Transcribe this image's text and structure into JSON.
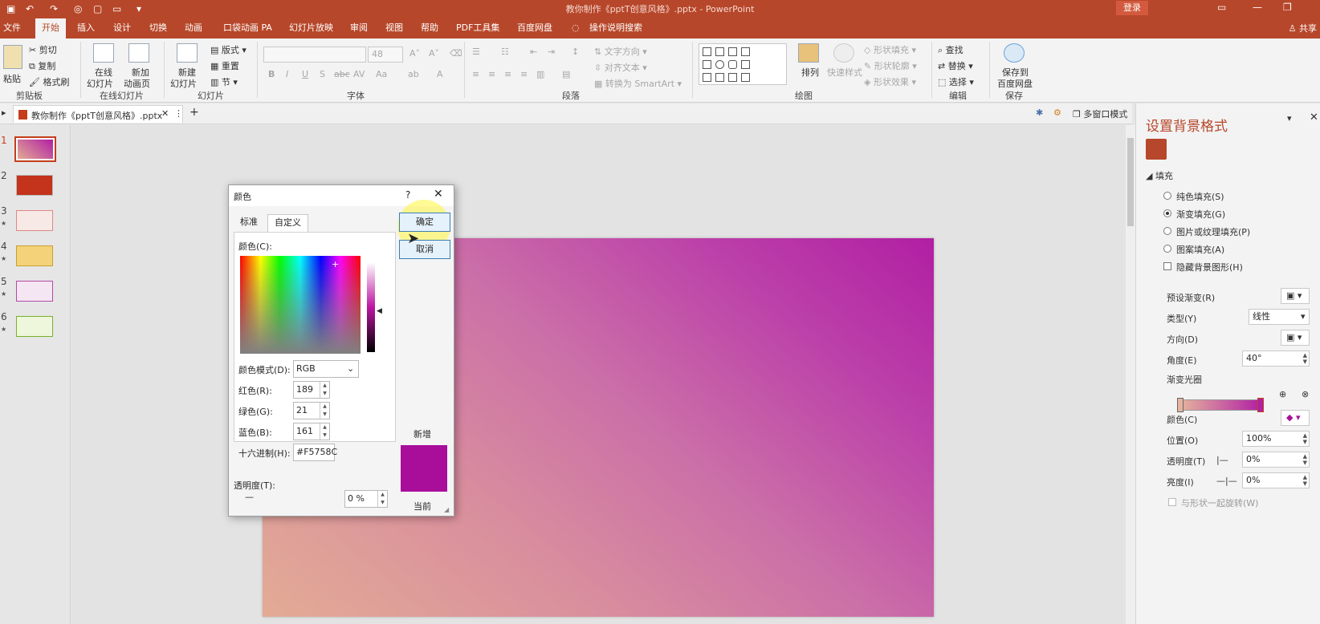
{
  "titlebar": {
    "doc_title": "教你制作《pptT创意风格》.pptx - PowerPoint",
    "login": "登录"
  },
  "tabs": [
    "文件",
    "开始",
    "插入",
    "设计",
    "切换",
    "动画",
    "口袋动画 PA",
    "幻灯片放映",
    "审阅",
    "视图",
    "帮助",
    "PDF工具集",
    "百度网盘"
  ],
  "active_tab": "开始",
  "search_hint": "操作说明搜索",
  "share": "共享",
  "ribbon": {
    "paste": "粘贴",
    "cut": "剪切",
    "copy": "复制",
    "format_painter": "格式刷",
    "online_slide_1": "在线",
    "online_slide_2": "幻灯片",
    "new_anim_1": "新加",
    "new_anim_2": "动画页",
    "new_slide_1": "新建",
    "new_slide_2": "幻灯片",
    "layout": "版式",
    "reset": "重置",
    "section": "节",
    "font_size": "48",
    "text_direction": "文字方向",
    "align_text": "对齐文本",
    "smartart": "转换为 SmartArt",
    "arrange": "排列",
    "quick_styles": "快速样式",
    "shape_fill": "形状填充",
    "shape_outline": "形状轮廓",
    "shape_effect": "形状效果",
    "find": "查找",
    "replace": "替换",
    "select": "选择",
    "save_1": "保存到",
    "save_2": "百度网盘",
    "groups": {
      "clipboard": "剪贴板",
      "online": "在线幻灯片",
      "slides": "幻灯片",
      "font": "字体",
      "paragraph": "段落",
      "drawing": "绘图",
      "editing": "编辑",
      "save": "保存"
    }
  },
  "doc_tab": "教你制作《pptT创意风格》.pptx",
  "multi_window": "多窗口模式",
  "thumbnails": [
    {
      "num": "1",
      "star": "",
      "selected": true
    },
    {
      "num": "2",
      "star": "",
      "selected": false
    },
    {
      "num": "3",
      "star": "★",
      "selected": false
    },
    {
      "num": "4",
      "star": "★",
      "selected": false
    },
    {
      "num": "5",
      "star": "★",
      "selected": false
    },
    {
      "num": "6",
      "star": "★",
      "selected": false
    }
  ],
  "dialog": {
    "title": "颜色",
    "help": "?",
    "tab_standard": "标准",
    "tab_custom": "自定义",
    "ok": "确定",
    "cancel": "取消",
    "colors_label": "颜色(C):",
    "mode_label": "颜色模式(D):",
    "mode_value": "RGB",
    "red_label": "红色(R):",
    "red": "189",
    "green_label": "绿色(G):",
    "green": "21",
    "blue_label": "蓝色(B):",
    "blue": "161",
    "hex_label": "十六进制(H):",
    "hex": "#F5758C",
    "transparency_label": "透明度(T):",
    "transparency": "0 %",
    "new": "新增",
    "current": "当前",
    "new_color": "#a80e9a"
  },
  "pane": {
    "title": "设置背景格式",
    "section": "填充",
    "solid": "纯色填充(S)",
    "gradient": "渐变填充(G)",
    "picture": "图片或纹理填充(P)",
    "pattern": "图案填充(A)",
    "hide_bg": "隐藏背景图形(H)",
    "preset": "预设渐变(R)",
    "type_label": "类型(Y)",
    "type_value": "线性",
    "direction": "方向(D)",
    "angle_label": "角度(E)",
    "angle_value": "40°",
    "stops": "渐变光圈",
    "color": "颜色(C)",
    "position_label": "位置(O)",
    "position_value": "100%",
    "transparency_label": "透明度(T)",
    "transparency_value": "0%",
    "brightness_label": "亮度(I)",
    "brightness_value": "0%",
    "rotate": "与形状一起旋转(W)"
  },
  "colors": {
    "accent": "#b7472a",
    "slide_start": "#e3ab95",
    "slide_end": "#b11fa3"
  }
}
